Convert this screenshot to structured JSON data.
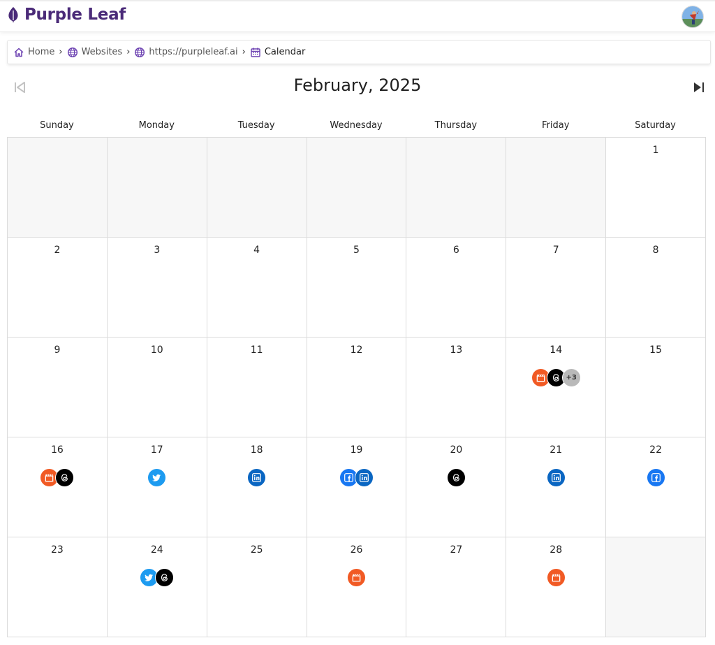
{
  "brand": {
    "name": "Purple Leaf",
    "color": "#4a2a78"
  },
  "breadcrumb": [
    {
      "label": "Home",
      "icon": "home-icon"
    },
    {
      "label": "Websites",
      "icon": "globe-icon"
    },
    {
      "label": "https://purpleleaf.ai",
      "icon": "globe-icon"
    },
    {
      "label": "Calendar",
      "icon": "calendar-icon"
    }
  ],
  "calendar": {
    "month_title": "February, 2025",
    "weekdays": [
      "Sunday",
      "Monday",
      "Tuesday",
      "Wednesday",
      "Thursday",
      "Friday",
      "Saturday"
    ],
    "weeks": [
      [
        {
          "day": ""
        },
        {
          "day": ""
        },
        {
          "day": ""
        },
        {
          "day": ""
        },
        {
          "day": ""
        },
        {
          "day": ""
        },
        {
          "day": "1"
        }
      ],
      [
        {
          "day": "2"
        },
        {
          "day": "3"
        },
        {
          "day": "4"
        },
        {
          "day": "5"
        },
        {
          "day": "6"
        },
        {
          "day": "7"
        },
        {
          "day": "8"
        }
      ],
      [
        {
          "day": "9"
        },
        {
          "day": "10"
        },
        {
          "day": "11"
        },
        {
          "day": "12"
        },
        {
          "day": "13"
        },
        {
          "day": "14",
          "posts": [
            "video",
            "threads"
          ],
          "more": "+3"
        },
        {
          "day": "15"
        }
      ],
      [
        {
          "day": "16",
          "posts": [
            "video",
            "threads"
          ]
        },
        {
          "day": "17",
          "posts": [
            "twitter"
          ]
        },
        {
          "day": "18",
          "posts": [
            "linkedin"
          ]
        },
        {
          "day": "19",
          "posts": [
            "facebook",
            "linkedin"
          ]
        },
        {
          "day": "20",
          "posts": [
            "threads"
          ]
        },
        {
          "day": "21",
          "posts": [
            "linkedin"
          ]
        },
        {
          "day": "22",
          "posts": [
            "facebook"
          ]
        }
      ],
      [
        {
          "day": "23"
        },
        {
          "day": "24",
          "posts": [
            "twitter",
            "threads"
          ]
        },
        {
          "day": "25"
        },
        {
          "day": "26",
          "posts": [
            "video"
          ]
        },
        {
          "day": "27"
        },
        {
          "day": "28",
          "posts": [
            "video"
          ]
        },
        {
          "day": ""
        }
      ]
    ]
  },
  "colors": {
    "video": "#f15a24",
    "threads": "#000000",
    "twitter": "#1d9bf0",
    "linkedin": "#0a66c2",
    "facebook": "#1877f2",
    "more": "#b9b9b9",
    "crumb_icon": "#6a3fb0"
  }
}
